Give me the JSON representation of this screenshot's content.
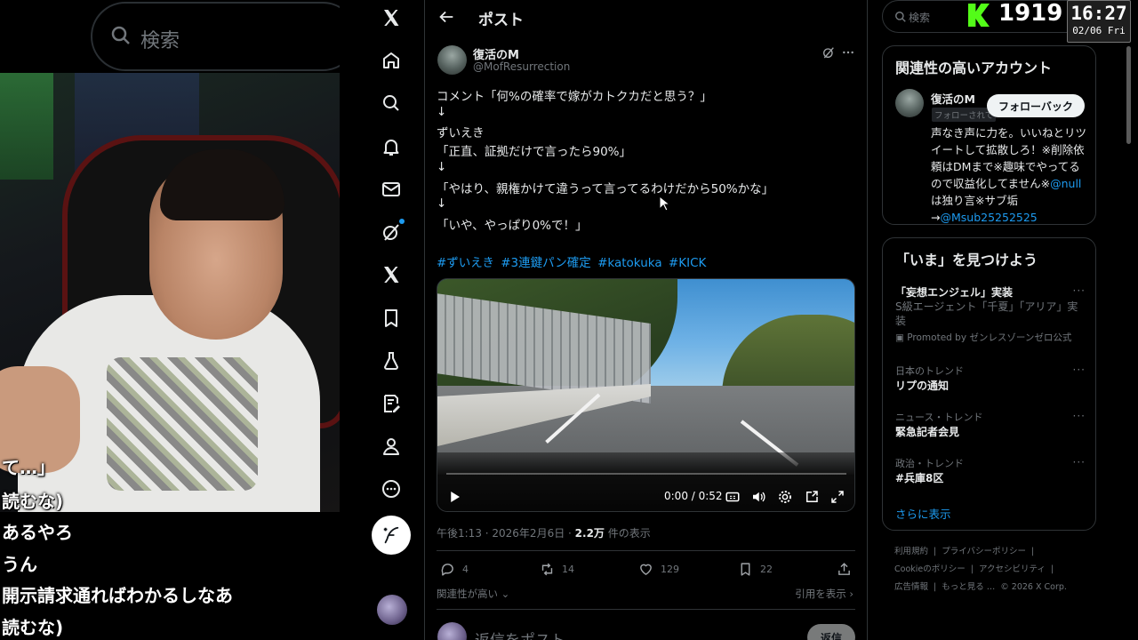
{
  "left_overlay": {
    "ghost_search_text": "検索",
    "chat_lines": [
      "て…」",
      "読むな)",
      "あるやろ",
      "うん",
      "開示請求通ればわかるしなあ",
      "読むな)"
    ]
  },
  "main": {
    "header_title": "ポスト",
    "author_name": "復活のM",
    "author_handle": "@MofResurrection",
    "lines": [
      "コメント「何%の確率で嫁がカトクカだと思う？」",
      "↓",
      "ずいえき",
      "「正直、証拠だけで言ったら90%」",
      "↓",
      "「やはり、親権かけて違うって言ってるわけだから50%かな」",
      "↓",
      "「いや、やっぱり0%で！」"
    ],
    "hashtags": [
      "#ずいえき",
      "#3連鍵パン確定",
      "#katokuka",
      "#KICK"
    ],
    "video": {
      "time": "0:00 / 0:52",
      "progress": 0
    },
    "meta_time": "午後1:13 · 2026年2月6日 ·",
    "meta_views": "2.2万",
    "meta_views_suffix": "件の表示",
    "actions": {
      "replies": "4",
      "reposts": "14",
      "likes": "129",
      "bookmarks": "22"
    },
    "relevance_label": "関連性が高い",
    "quotes_label": "引用を表示",
    "reply_placeholder": "返信をポスト",
    "reply_button": "返信"
  },
  "right": {
    "search_placeholder": "検索",
    "kick_count": "1919",
    "clock_time": "16:27",
    "clock_date": "02/06 Fri",
    "related_title": "関連性の高いアカウント",
    "related_name": "復活のM",
    "related_badge": "フォローされて",
    "follow_back_label": "フォローバック",
    "related_bio": "声なき声に力を。いいねとリツイートして拡散しろ！※削除依頼はDMまで※趣味でやってるので収益化してません※",
    "related_bio_link1": "@null",
    "related_bio_mid": "は独り言※サブ垢→",
    "related_bio_link2": "@Msub25252525",
    "whats_happening_title": "「いま」を見つけよう",
    "trends": [
      {
        "name": "「妄想エンジェル」実装",
        "desc": "S級エージェント「千夏」「アリア」実装",
        "promo": "Promoted by ゼンレスゾーンゼロ公式"
      },
      {
        "category": "日本のトレンド",
        "name": "リプの通知"
      },
      {
        "category": "ニュース・トレンド",
        "name": "緊急記者会見"
      },
      {
        "category": "政治・トレンド",
        "name": "#兵庫8区"
      }
    ],
    "show_more": "さらに表示",
    "footer_line1": [
      "利用規約",
      "|",
      "プライバシーポリシー",
      "|"
    ],
    "footer_line2": [
      "Cookieのポリシー",
      "|",
      "アクセシビリティ",
      "|"
    ],
    "footer_line3": [
      "広告情報",
      "|",
      "もっと見る …",
      "© 2026 X Corp."
    ]
  }
}
